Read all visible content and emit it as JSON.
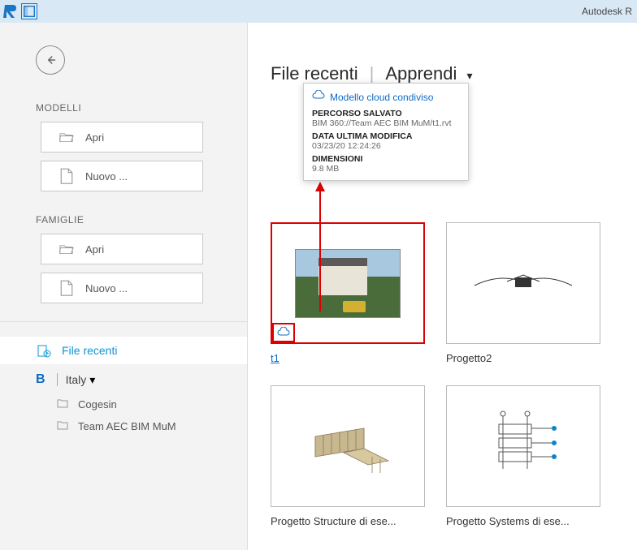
{
  "app_title": "Autodesk R",
  "sidebar": {
    "sections": {
      "models": "MODELLI",
      "families": "FAMIGLIE"
    },
    "buttons": {
      "models_open": "Apri",
      "models_new": "Nuovo ...",
      "families_open": "Apri",
      "families_new": "Nuovo ..."
    },
    "nav": {
      "recent_files": "File recenti"
    },
    "b360": {
      "region": "Italy",
      "projects": [
        "Cogesin",
        "Team AEC BIM MuM"
      ]
    }
  },
  "content": {
    "tabs": {
      "recent": "File recenti",
      "learn": "Apprendi"
    },
    "tooltip": {
      "title": "Modello cloud condiviso",
      "path_label": "PERCORSO SALVATO",
      "path_value": "BIM 360://Team AEC BIM MuM/t1.rvt",
      "date_label": "DATA ULTIMA MODIFICA",
      "date_value": "03/23/20 12:24:26",
      "size_label": "DIMENSIONI",
      "size_value": "9.8 MB"
    },
    "cards": [
      {
        "title": "t1"
      },
      {
        "title": "Progetto2"
      },
      {
        "title": "Progetto Structure di ese..."
      },
      {
        "title": "Progetto Systems di ese..."
      }
    ]
  }
}
